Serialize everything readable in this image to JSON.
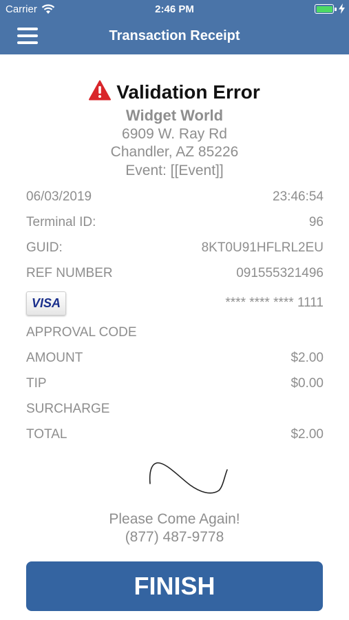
{
  "status_bar": {
    "carrier": "Carrier",
    "time": "2:46 PM",
    "battery_color": "#4cd964"
  },
  "nav": {
    "title": "Transaction Receipt",
    "menu_icon": "hamburger-menu-icon",
    "bar_color": "#4a74a8"
  },
  "receipt": {
    "error_title": "Validation Error",
    "error_icon": "warning-triangle-icon",
    "merchant_name": "Widget World",
    "address_line1": "6909 W. Ray Rd",
    "address_line2": "Chandler, AZ 85226",
    "event": "Event: [[Event]]",
    "rows": [
      {
        "label": "06/03/2019",
        "value": "23:46:54"
      },
      {
        "label": "Terminal ID:",
        "value": "96"
      },
      {
        "label": "GUID:",
        "value": "8KT0U91HFLRL2EU"
      },
      {
        "label": "REF NUMBER",
        "value": "091555321496"
      }
    ],
    "card": {
      "brand": "VISA",
      "icon": "visa-card-icon",
      "masked_number": "**** **** **** 1111"
    },
    "amounts": [
      {
        "label": "APPROVAL CODE",
        "value": ""
      },
      {
        "label": "AMOUNT",
        "value": "$2.00"
      },
      {
        "label": "TIP",
        "value": "$0.00"
      },
      {
        "label": "SURCHARGE",
        "value": ""
      },
      {
        "label": "TOTAL",
        "value": "$2.00"
      }
    ],
    "signature_icon": "signature-icon",
    "footer_message": "Please Come Again!",
    "phone": "(877) 487-9778"
  },
  "actions": {
    "finish_label": "FINISH",
    "button_color": "#3464a1"
  }
}
